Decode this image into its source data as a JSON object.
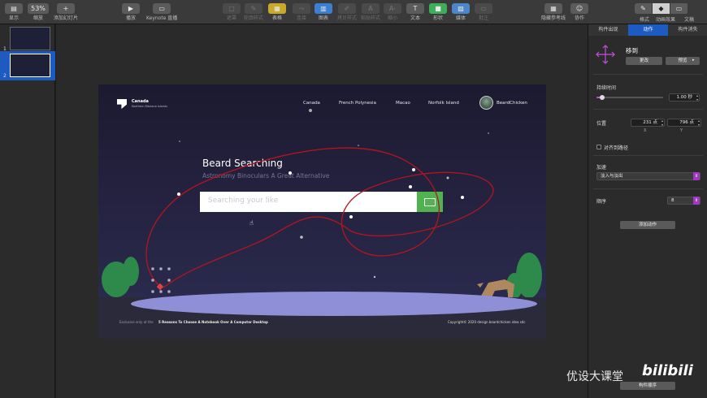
{
  "toolbar": {
    "view_label": "显示",
    "zoom_value": "53%",
    "zoom_label": "缩放",
    "add_slide_label": "添加幻灯片",
    "play_label": "播放",
    "keynote_live_label": "Keynote 直播",
    "table_label": "表格",
    "chart_label": "图表",
    "text_label": "文本",
    "shape_label": "形状",
    "media_label": "媒体",
    "comment_label": "批注",
    "hide_guides_label": "隐藏参考线",
    "collaborate_label": "协作",
    "format_label": "格式",
    "animate_label": "动画效果",
    "document_label": "文稿",
    "disabled_labels": [
      "遮罩",
      "轮廓样式",
      "连接",
      "拷贝样式",
      "粘贴样式",
      "缩小",
      "放大"
    ]
  },
  "navigator": {
    "slides": [
      {
        "number": "1"
      },
      {
        "number": "2"
      }
    ],
    "selected_index": 1
  },
  "slide": {
    "brand_name": "Canada",
    "brand_sub": "Northern Mariana Islands",
    "nav_items": [
      "Canada",
      "French Polynesia",
      "Macao",
      "Norfolk Island"
    ],
    "user_name": "BeardChicken",
    "hero_title": "Beard Searching",
    "hero_subtitle": "Astronomy Binoculars A Great Alternative",
    "search_placeholder": "Searching your like",
    "footer_left": "Exclusive only at the",
    "footer_link": "5 Reasons To Choose A Notebook Over A Computer Desktop",
    "footer_right": "Copyright© 2020 design beardchicken idea sdc"
  },
  "inspector": {
    "tabs": [
      "构件出现",
      "动作",
      "构件消失"
    ],
    "active_tab": 1,
    "effect_name": "移到",
    "change_button": "更改",
    "preview_button": "预览",
    "duration_label": "持续时间",
    "duration_value": "1.00 秒",
    "duration_fraction": 0.08,
    "position_label": "位置",
    "position_x": "231 点",
    "position_y": "796 点",
    "x_label": "X",
    "y_label": "Y",
    "align_path_label": "对齐到路径",
    "align_path_checked": false,
    "acceleration_label": "加速",
    "acceleration_value": "淡入与淡出",
    "order_label": "顺序",
    "order_value": "8",
    "add_action_button": "添加动作",
    "build_order_button": "构件顺序",
    "accent_color": "#a238c4"
  },
  "watermark": {
    "text": "优设大课堂",
    "logo": "bilibili"
  }
}
